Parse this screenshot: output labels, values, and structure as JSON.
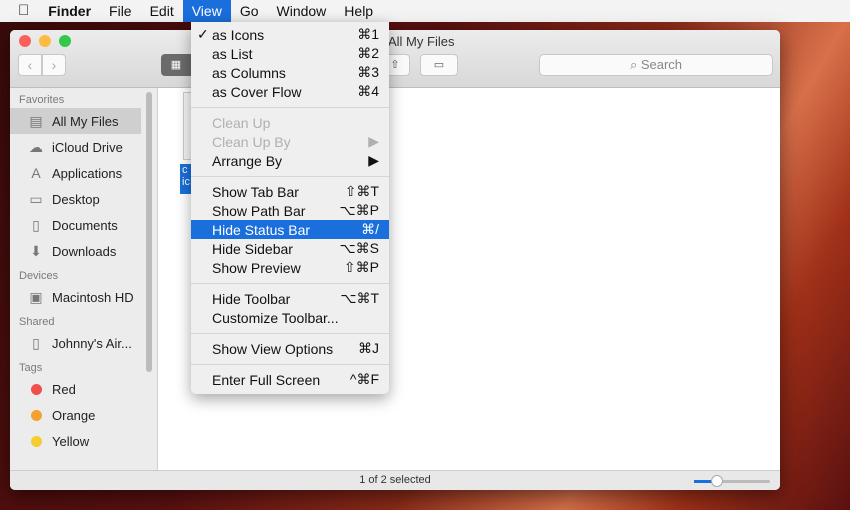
{
  "menubar": {
    "apple": "",
    "items": [
      "Finder",
      "File",
      "Edit",
      "View",
      "Go",
      "Window",
      "Help"
    ]
  },
  "window": {
    "title": "All My Files",
    "search_placeholder": "Search",
    "status": "1 of 2 selected",
    "icon_size": 0.3
  },
  "sidebar": {
    "favorites_label": "Favorites",
    "favorites": [
      {
        "label": "All My Files",
        "icon": "all-files-icon",
        "glyph": "▤"
      },
      {
        "label": "iCloud Drive",
        "icon": "cloud-icon",
        "glyph": "☁"
      },
      {
        "label": "Applications",
        "icon": "applications-icon",
        "glyph": "A"
      },
      {
        "label": "Desktop",
        "icon": "desktop-icon",
        "glyph": "▭"
      },
      {
        "label": "Documents",
        "icon": "documents-icon",
        "glyph": "▯"
      },
      {
        "label": "Downloads",
        "icon": "downloads-icon",
        "glyph": "⬇"
      }
    ],
    "devices_label": "Devices",
    "devices": [
      {
        "label": "Macintosh HD",
        "icon": "hard-drive-icon",
        "glyph": "▣"
      }
    ],
    "shared_label": "Shared",
    "shared": [
      {
        "label": "Johnny's Air...",
        "icon": "laptop-icon",
        "glyph": "▯"
      }
    ],
    "tags_label": "Tags",
    "tags": [
      {
        "label": "Red",
        "color": "#f0504a"
      },
      {
        "label": "Orange",
        "color": "#f5a130"
      },
      {
        "label": "Yellow",
        "color": "#f5cd2f"
      }
    ]
  },
  "file": {
    "label_fragment": "c ic"
  },
  "view_menu": {
    "groups": [
      [
        {
          "label": "as Icons",
          "shortcut": "⌘1",
          "checked": true
        },
        {
          "label": "as List",
          "shortcut": "⌘2"
        },
        {
          "label": "as Columns",
          "shortcut": "⌘3"
        },
        {
          "label": "as Cover Flow",
          "shortcut": "⌘4"
        }
      ],
      [
        {
          "label": "Clean Up",
          "shortcut": "",
          "disabled": true
        },
        {
          "label": "Clean Up By",
          "shortcut": "▶",
          "disabled": true
        },
        {
          "label": "Arrange By",
          "shortcut": "▶"
        }
      ],
      [
        {
          "label": "Show Tab Bar",
          "shortcut": "⇧⌘T"
        },
        {
          "label": "Show Path Bar",
          "shortcut": "⌥⌘P"
        },
        {
          "label": "Hide Status Bar",
          "shortcut": "⌘/",
          "highlighted": true
        },
        {
          "label": "Hide Sidebar",
          "shortcut": "⌥⌘S"
        },
        {
          "label": "Show Preview",
          "shortcut": "⇧⌘P"
        }
      ],
      [
        {
          "label": "Hide Toolbar",
          "shortcut": "⌥⌘T"
        },
        {
          "label": "Customize Toolbar...",
          "shortcut": ""
        }
      ],
      [
        {
          "label": "Show View Options",
          "shortcut": "⌘J"
        }
      ],
      [
        {
          "label": "Enter Full Screen",
          "shortcut": "^⌘F"
        }
      ]
    ]
  }
}
